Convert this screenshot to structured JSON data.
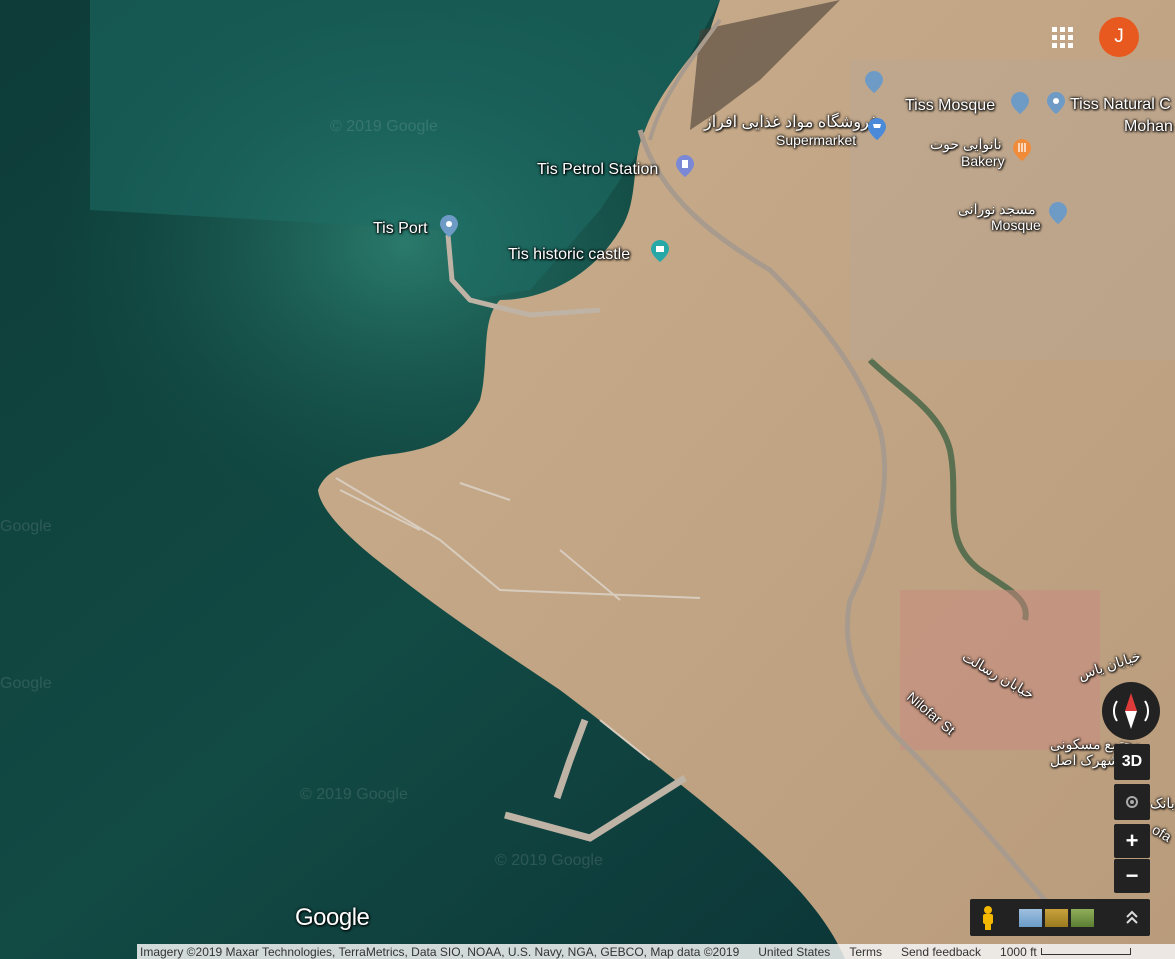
{
  "places": {
    "tiss_mosque": "Tiss Mosque",
    "tiss_natural": "Tiss Natural C",
    "mohan": "Mohan",
    "supermarket_fa": "فروشگاه مواد غذایی افراز",
    "supermarket": "Supermarket",
    "bakery_fa": "نانوایی حوت",
    "bakery": "Bakery",
    "petrol": "Tis Petrol Station",
    "mosque_fa": "مسجد نورانی",
    "mosque": "Mosque",
    "port": "Tis Port",
    "castle": "Tis historic castle",
    "street_fa1": "خیابان یاس",
    "street_fa2": "خیابان رسالت",
    "niloofar": "Nilofar St",
    "residential_fa1": "مجتمع مسکونی",
    "residential_fa2": "شهرک اصل",
    "bank_fa": "بانک",
    "ofa": "ofa"
  },
  "watermarks": [
    "© 2019 Google",
    "Google",
    "Google",
    "© 2019 Google",
    "© 2019 Google"
  ],
  "controls": {
    "avatar_letter": "J",
    "view_3d": "3D",
    "zoom_in": "+",
    "zoom_out": "−",
    "compass_icon": "compass-icon",
    "pegman_icon": "pegman-icon",
    "apps_icon": "apps-grid-icon"
  },
  "logo": "Google",
  "attribution": {
    "imagery": "Imagery ©2019 Maxar Technologies, TerraMetrics, Data SIO, NOAA, U.S. Navy, NGA, GEBCO, Map data ©2019",
    "region": "United States",
    "terms": "Terms",
    "feedback": "Send feedback",
    "scale": "1000 ft"
  },
  "colors": {
    "sea_deep": "#0d3a3a",
    "sea_shallow": "#1d6a62",
    "land": "#c4a887",
    "pin_blue": "#6e9bc6",
    "pin_orange": "#f08b3a",
    "avatar": "#e8591f"
  }
}
